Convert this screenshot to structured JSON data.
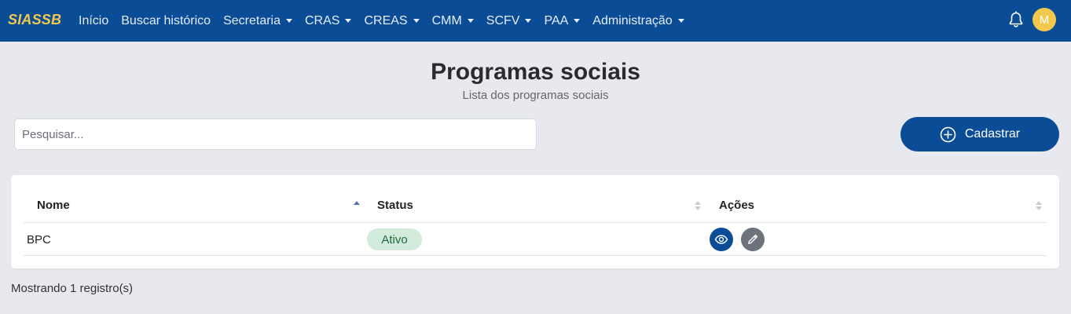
{
  "navbar": {
    "brand": "SIASSB",
    "items": [
      {
        "label": "Início",
        "dropdown": false
      },
      {
        "label": "Buscar histórico",
        "dropdown": false
      },
      {
        "label": "Secretaria",
        "dropdown": true
      },
      {
        "label": "CRAS",
        "dropdown": true
      },
      {
        "label": "CREAS",
        "dropdown": true
      },
      {
        "label": "CMM",
        "dropdown": true
      },
      {
        "label": "SCFV",
        "dropdown": true
      },
      {
        "label": "PAA",
        "dropdown": true
      },
      {
        "label": "Administração",
        "dropdown": true
      }
    ],
    "notification_icon": "bell-icon",
    "avatar_initial": "M"
  },
  "header": {
    "title": "Programas sociais",
    "subtitle": "Lista dos programas sociais"
  },
  "search": {
    "placeholder": "Pesquisar...",
    "value": ""
  },
  "add_button": {
    "label": "Cadastrar",
    "icon": "plus-circle-icon"
  },
  "table": {
    "columns": [
      "Nome",
      "Status",
      "Ações"
    ],
    "sorted_column": "Nome",
    "sort_direction": "asc",
    "rows": [
      {
        "nome": "BPC",
        "status": "Ativo",
        "actions": [
          "eye-icon",
          "pencil-icon"
        ]
      }
    ]
  },
  "footer": {
    "records_text": "Mostrando 1 registro(s)"
  },
  "colors": {
    "primary": "#0b4c97",
    "brand": "#f2c94c",
    "background": "#e7e9ee",
    "status_active_bg": "#d3ebdc",
    "status_active_text": "#1f6b3a",
    "edit_button": "#6c737b"
  }
}
